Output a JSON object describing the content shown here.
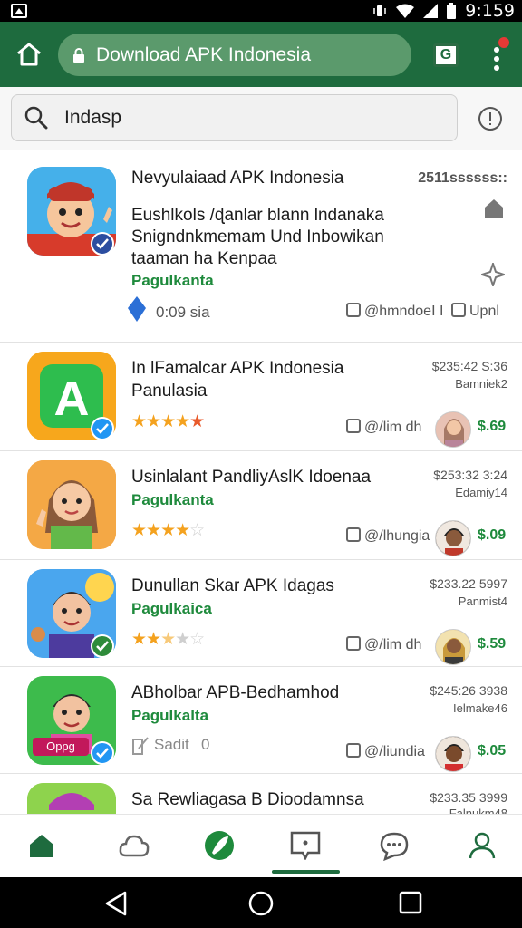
{
  "status_bar": {
    "time": "9:159"
  },
  "browser": {
    "url": "Download APK Indonesia"
  },
  "search": {
    "query": "Indasp"
  },
  "accent": "#1e6b3e",
  "items": [
    {
      "title": "Nevyulaiaad APK Indonesia",
      "price": "2511ssssss::",
      "desc_lines": [
        "Eushlkols /ɖanlar blann lndanaka",
        "Snigndnkmemam Und Inbowikan",
        "taaman ha Kenpaa"
      ],
      "developer": "Pagulkanta",
      "meta": "0:09 sia",
      "action1": "@hmndoeI I",
      "action2": "Upnl"
    },
    {
      "title": "In lFamalcar APK Indonesia",
      "title2": "Panulasia",
      "price": "$235:42 S:36",
      "sub": "Bamniek2",
      "rating": 4.5,
      "action1": "@/lim dh",
      "amount": "$.69"
    },
    {
      "title": "Usinlalant PandliyAslK Idoenaa",
      "developer": "Pagulkanta",
      "price": "$253:32 3:24",
      "sub": "Edamiy14",
      "rating": 4,
      "action1": "@/lhungia",
      "amount": "$.09"
    },
    {
      "title": "Dunullan Skar APK Idagas",
      "developer": "Pagulkaica",
      "price": "$233.22 5997",
      "sub": "Panmist4",
      "rating": 2.5,
      "action1": "@/lim dh",
      "amount": "$.59"
    },
    {
      "title": "ABholbar APB-Bedhamhod",
      "developer": "Pagulkalta",
      "price": "$245:26 3938",
      "sub": "Ielmake46",
      "meta_label": "Sadit",
      "meta_value": "0",
      "icon_label": "Oppg",
      "action1": "@/liundia",
      "amount": "$.05"
    },
    {
      "title": "Sa Rewliagasa B Dioodamnsa",
      "price": "$233.35 3999",
      "sub": "Falnukm48"
    }
  ]
}
